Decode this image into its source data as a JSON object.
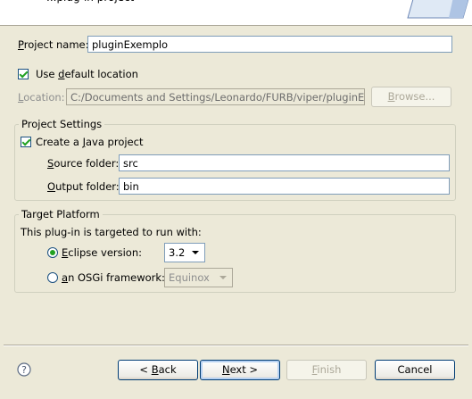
{
  "header": {
    "title": "Plug-in Project",
    "title_visible": "...plug-in project"
  },
  "project_name": {
    "label": "Project name:",
    "value": "pluginExemplo"
  },
  "use_default_location": {
    "label": "Use default location",
    "checked": true
  },
  "location": {
    "label": "Location:",
    "value": "C:/Documents and Settings/Leonardo/FURB/viper/pluginExer",
    "browse_label": "Browse..."
  },
  "project_settings": {
    "title": "Project Settings",
    "create_java": {
      "label": "Create a Java project",
      "checked": true
    },
    "source_folder": {
      "label": "Source folder:",
      "value": "src"
    },
    "output_folder": {
      "label": "Output folder:",
      "value": "bin"
    }
  },
  "target_platform": {
    "title": "Target Platform",
    "description": "This plug-in is targeted to run with:",
    "eclipse": {
      "label": "Eclipse version:",
      "value": "3.2",
      "selected": true
    },
    "osgi": {
      "label": "an OSGi framework:",
      "value": "Equinox",
      "selected": false
    }
  },
  "buttons": {
    "help": "?",
    "back": "< Back",
    "next": "Next >",
    "finish": "Finish",
    "cancel": "Cancel"
  }
}
